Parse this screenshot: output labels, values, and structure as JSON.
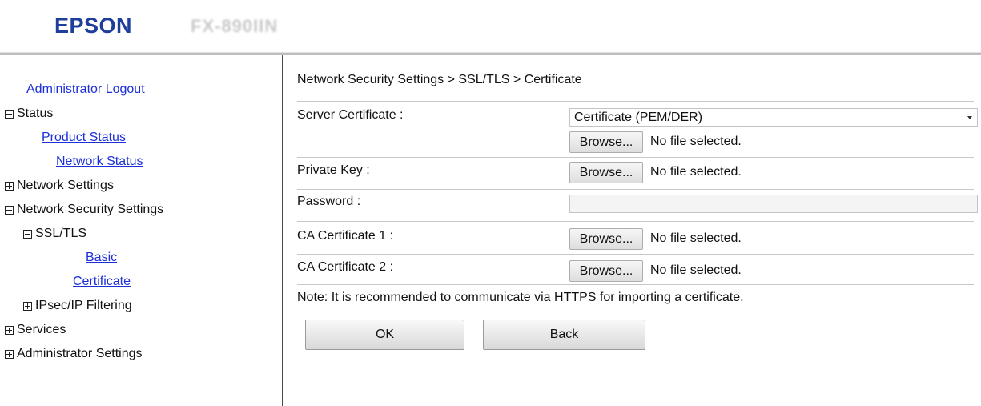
{
  "header": {
    "brand": "EPSON",
    "model": "FX-890IIN"
  },
  "sidebar": {
    "admin_logout": "Administrator Logout",
    "status": {
      "label": "Status",
      "expanded": true
    },
    "product_status": "Product Status",
    "network_status": "Network Status",
    "network_settings": {
      "label": "Network Settings",
      "expanded": false
    },
    "network_security_settings": {
      "label": "Network Security Settings",
      "expanded": true
    },
    "ssl_tls": {
      "label": "SSL/TLS",
      "expanded": true
    },
    "basic": "Basic",
    "certificate": "Certificate",
    "ipsec": {
      "label": "IPsec/IP Filtering",
      "expanded": false
    },
    "services": {
      "label": "Services",
      "expanded": false
    },
    "administrator_settings": {
      "label": "Administrator Settings",
      "expanded": false
    }
  },
  "main": {
    "breadcrumb": "Network Security Settings > SSL/TLS > Certificate",
    "server_certificate": {
      "label": "Server Certificate :",
      "selected": "Certificate (PEM/DER)"
    },
    "browse_label": "Browse...",
    "no_file": "No file selected.",
    "private_key_label": "Private Key :",
    "password_label": "Password :",
    "ca_cert_1_label": "CA Certificate 1 :",
    "ca_cert_2_label": "CA Certificate 2 :",
    "note": "Note: It is recommended to communicate via HTTPS for importing a certificate.",
    "ok_label": "OK",
    "back_label": "Back"
  },
  "colors": {
    "brand": "#1f3e9c",
    "link": "#1c2fd8"
  }
}
